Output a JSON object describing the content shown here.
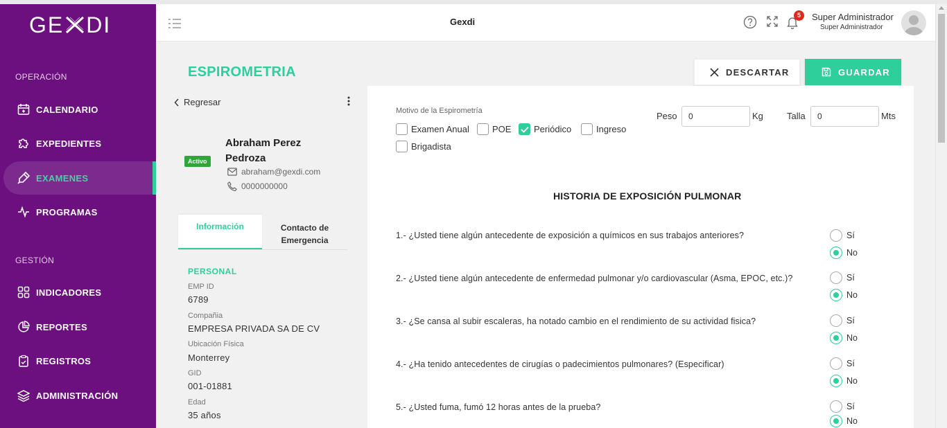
{
  "app": {
    "logo": "GEXDI",
    "header_title": "Gexdi"
  },
  "colors": {
    "sidebar": "#6c0f7f",
    "accent": "#2fcf9c",
    "badge": "#e0281c",
    "status_active": "#2fa63a"
  },
  "sidebar": {
    "section_operacion": "OPERACIÓN",
    "section_gestion": "GESTIÓN",
    "items": [
      {
        "label": "CALENDARIO",
        "icon": "calendar-icon"
      },
      {
        "label": "EXPEDIENTES",
        "icon": "puzzle-icon"
      },
      {
        "label": "EXAMENES",
        "icon": "pipette-icon",
        "active": true
      },
      {
        "label": "PROGRAMAS",
        "icon": "pulse-icon"
      },
      {
        "label": "INDICADORES",
        "icon": "grid-icon"
      },
      {
        "label": "REPORTES",
        "icon": "pie-chart-icon"
      },
      {
        "label": "REGISTROS",
        "icon": "clipboard-icon"
      },
      {
        "label": "ADMINISTRACIÓN",
        "icon": "layers-icon"
      }
    ]
  },
  "header": {
    "notification_count": "5",
    "user_name": "Super Administrador",
    "user_role": "Super Administrador"
  },
  "page": {
    "title": "ESPIROMETRIA",
    "discard_label": "DESCARTAR",
    "save_label": "GUARDAR"
  },
  "profile": {
    "back_label": "Regresar",
    "status": "Activo",
    "name": "Abraham Perez Pedroza",
    "email": "abraham@gexdi.com",
    "phone": "0000000000",
    "tabs": [
      "Información",
      "Contacto de Emergencia"
    ],
    "section": "PERSONAL",
    "fields": [
      {
        "label": "EMP ID",
        "value": "6789"
      },
      {
        "label": "Compañia",
        "value": "EMPRESA PRIVADA SA DE CV"
      },
      {
        "label": "Ubicación Física",
        "value": "Monterrey"
      },
      {
        "label": "GID",
        "value": "001-01881"
      },
      {
        "label": "Edad",
        "value": "35 años"
      }
    ]
  },
  "form": {
    "motivo_label": "Motivo de la Espirometría",
    "motivos": [
      {
        "label": "Examen Anual",
        "checked": false
      },
      {
        "label": "POE",
        "checked": false
      },
      {
        "label": "Periódico",
        "checked": true
      },
      {
        "label": "Ingreso",
        "checked": false
      },
      {
        "label": "Brigadista",
        "checked": false
      }
    ],
    "peso_label": "Peso",
    "peso_value": "0",
    "peso_unit": "Kg",
    "talla_label": "Talla",
    "talla_value": "0",
    "talla_unit": "Mts",
    "history_title": "HISTORIA DE EXPOSICIÓN PULMONAR",
    "yes_label": "Sí",
    "no_label": "No",
    "questions": [
      {
        "text": "1.- ¿Usted tiene algún antecedente de exposición a químicos en sus trabajos anteriores?",
        "answer": "No"
      },
      {
        "text": "2.- ¿Usted tiene algún antecedente de enfermedad pulmonar y/o cardiovascular (Asma, EPOC, etc.)?",
        "answer": "No"
      },
      {
        "text": "3.- ¿Se cansa al subir escaleras, ha notado cambio en el rendimiento de su actividad fisica?",
        "answer": "No"
      },
      {
        "text": "4.- ¿Ha tenido antecedentes de cirugías o padecimientos pulmonares? (Especificar)",
        "answer": "No"
      },
      {
        "text": "5.- ¿Usted fuma, fumó 12 horas antes de la prueba?",
        "answer": "No"
      }
    ]
  }
}
